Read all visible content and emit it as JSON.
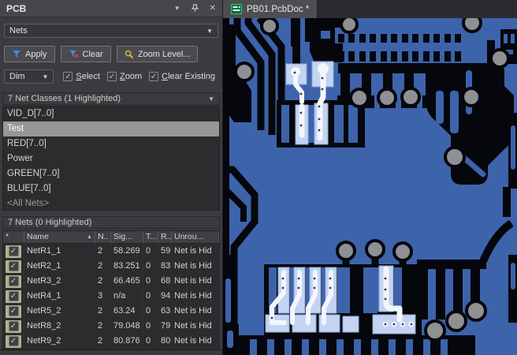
{
  "panel": {
    "title": "PCB",
    "selector": {
      "value": "Nets"
    },
    "toolbar": {
      "apply": "Apply",
      "clear": "Clear",
      "zoom_level": "Zoom Level..."
    },
    "dim": {
      "value": "Dim",
      "checks": [
        {
          "initial": "S",
          "rest": "elect"
        },
        {
          "initial": "Z",
          "rest": "oom"
        },
        {
          "initial": "C",
          "rest": "lear Existing"
        }
      ]
    },
    "classes": {
      "header": "7 Net Classes (1 Highlighted)",
      "items": [
        {
          "label": "VID_D[7..0]"
        },
        {
          "label": "Test"
        },
        {
          "label": "RED[7..0]"
        },
        {
          "label": "Power"
        },
        {
          "label": "GREEN[7..0]"
        },
        {
          "label": "BLUE[7..0]"
        },
        {
          "label": "<All Nets>"
        }
      ]
    },
    "nets": {
      "header": "7 Nets (0 Highlighted)",
      "columns": [
        "*",
        "Name",
        "N..",
        "Sig...",
        "T...",
        "R...",
        "Unrou..."
      ],
      "rows": [
        {
          "name": "NetR1_1",
          "n": "2",
          "sig": "58.269",
          "t": "0",
          "r": "59",
          "unrouted": "Net is Hid"
        },
        {
          "name": "NetR2_1",
          "n": "2",
          "sig": "83.251",
          "t": "0",
          "r": "83.",
          "unrouted": "Net is Hid"
        },
        {
          "name": "NetR3_2",
          "n": "2",
          "sig": "66.465",
          "t": "0",
          "r": "68.",
          "unrouted": "Net is Hid"
        },
        {
          "name": "NetR4_1",
          "n": "3",
          "sig": "n/a",
          "t": "0",
          "r": "94.",
          "unrouted": "Net is Hid"
        },
        {
          "name": "NetR5_2",
          "n": "2",
          "sig": "63.24",
          "t": "0",
          "r": "63.",
          "unrouted": "Net is Hid"
        },
        {
          "name": "NetR8_2",
          "n": "2",
          "sig": "79.048",
          "t": "0",
          "r": "79.",
          "unrouted": "Net is Hid"
        },
        {
          "name": "NetR9_2",
          "n": "2",
          "sig": "80.876",
          "t": "0",
          "r": "80.",
          "unrouted": "Net is Hid"
        }
      ]
    }
  },
  "document": {
    "tab_label": "PB01.PcbDoc *"
  },
  "icons": {
    "dropdown": "▼",
    "close": "✕",
    "check": "✓",
    "sort_asc": "▲"
  },
  "colors": {
    "pcb_copper_blue": "#3d63ab",
    "pcb_background_black": "#06070d",
    "pcb_pad_highlight": "#c3d4f2",
    "pcb_net_highlight_white": "#f4f6fc",
    "pcb_via_gray": "#8f9093",
    "selection_gray": "#979797",
    "checkbox_cell_khaki": "#b2b28b"
  }
}
